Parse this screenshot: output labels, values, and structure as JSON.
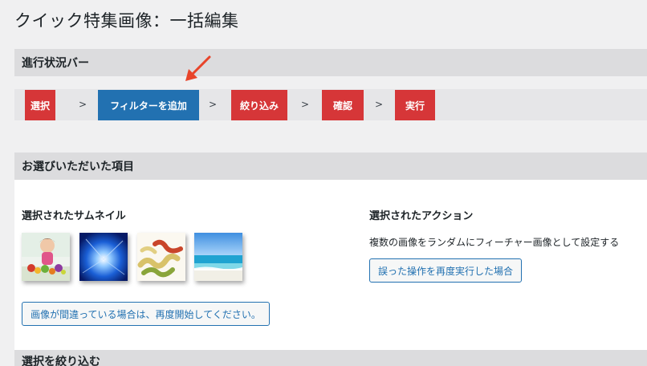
{
  "page": {
    "title": "クイック特集画像：一括編集"
  },
  "progress_section": {
    "header": "進行状況バー",
    "steps": [
      {
        "label": "選択",
        "state": "done",
        "color": "#d63638"
      },
      {
        "label": "フィルターを追加",
        "state": "current",
        "color": "#2271b1"
      },
      {
        "label": "絞り込み",
        "state": "pending",
        "color": "#d63638"
      },
      {
        "label": "確認",
        "state": "pending",
        "color": "#d63638"
      },
      {
        "label": "実行",
        "state": "pending",
        "color": "#d63638"
      }
    ],
    "separator": ">"
  },
  "selected_section": {
    "header": "お選びいただいた項目",
    "thumbnails": {
      "heading": "選択されたサムネイル",
      "items": [
        {
          "icon": "child-with-fruit-image"
        },
        {
          "icon": "blue-light-burst-image"
        },
        {
          "icon": "pasta-fusilli-image"
        },
        {
          "icon": "beach-ocean-image"
        }
      ],
      "restart_button": "画像が間違っている場合は、再度開始してください。"
    },
    "action": {
      "heading": "選択されたアクション",
      "description": "複数の画像をランダムにフィーチャー画像として設定する",
      "restart_button": "誤った操作を再度実行した場合"
    }
  },
  "narrow_section": {
    "header": "選択を絞り込む"
  },
  "colors": {
    "accent_blue": "#2271b1",
    "step_red": "#d63638",
    "arrow": "#e8442a"
  }
}
